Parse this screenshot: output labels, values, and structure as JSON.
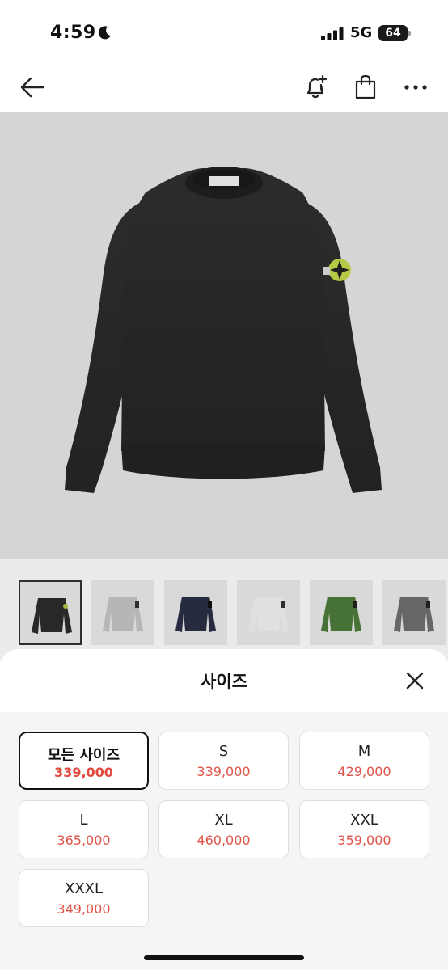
{
  "status_bar": {
    "time": "4:59",
    "network": "5G",
    "battery": "64"
  },
  "nav": {
    "back_icon": "arrow-left-icon",
    "alert_icon": "bell-plus-icon",
    "bag_icon": "shopping-bag-icon",
    "more_icon": "more-horizontal-icon"
  },
  "product": {
    "image": "crewneck-sweatshirt",
    "thumbnails": [
      {
        "color": "#2b2d2b",
        "selected": true
      },
      {
        "color": "#c6c6c6",
        "selected": false
      },
      {
        "color": "#2a2f45",
        "selected": false
      },
      {
        "color": "#eeeeee",
        "selected": false
      },
      {
        "color": "#4d7d3a",
        "selected": false
      },
      {
        "color": "#6f6f6f",
        "selected": false
      }
    ]
  },
  "sheet": {
    "title": "사이즈",
    "close_icon": "close-icon",
    "sizes": [
      {
        "label": "모든 사이즈",
        "price": "339,000",
        "active": true
      },
      {
        "label": "S",
        "price": "339,000",
        "active": false
      },
      {
        "label": "M",
        "price": "429,000",
        "active": false
      },
      {
        "label": "L",
        "price": "365,000",
        "active": false
      },
      {
        "label": "XL",
        "price": "460,000",
        "active": false
      },
      {
        "label": "XXL",
        "price": "359,000",
        "active": false
      },
      {
        "label": "XXXL",
        "price": "349,000",
        "active": false
      }
    ]
  },
  "colors": {
    "price_red": "#e0544a",
    "hero_bg": "#e8e8e8",
    "sheet_bg": "#f5f5f5"
  }
}
